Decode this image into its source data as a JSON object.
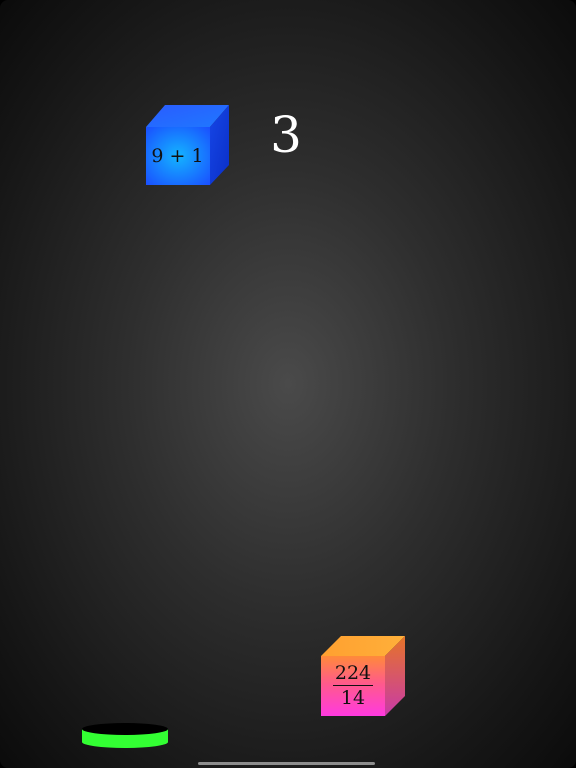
{
  "game": {
    "score": "3",
    "blocks": [
      {
        "kind": "expression",
        "text": "9 + 1",
        "color_top": "#1a5fff",
        "color_front": "#14b4ff",
        "color_side": "#0a33d6"
      },
      {
        "kind": "fraction",
        "numerator": "224",
        "denominator": "14",
        "color_top": "#ffa436",
        "color_front": "#ff5ab0",
        "color_side": "#e0485e"
      }
    ],
    "paddle": {
      "rim_color": "#33ff33",
      "top_color": "#000000"
    }
  }
}
